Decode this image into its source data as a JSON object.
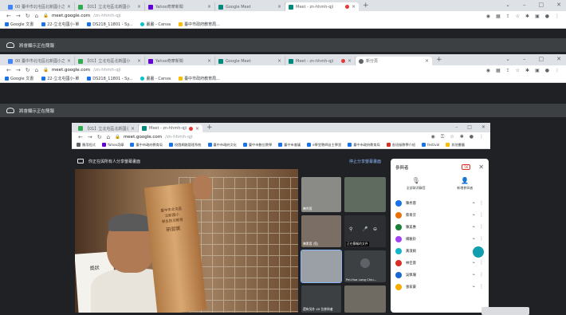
{
  "browser1": {
    "tabs": [
      {
        "label": "00 臺中市北屯區北新國小之課"
      },
      {
        "label": "【01】立北屯區北新國小"
      },
      {
        "label": "Yahoo奇摩新聞"
      },
      {
        "label": "Google Meet"
      },
      {
        "label": "Meet - zn-hhmh-qji"
      }
    ],
    "new_tab": "+",
    "url_domain": "meet.google.com",
    "url_path": "/zn-hhmh-qji",
    "bookmarks": [
      "Google 文書",
      "22-立北屯國小-單",
      "DS218_11801 - Sy...",
      "畫畫 - Canva",
      "臺中市政府教育局..."
    ],
    "present_label": "將會顯示正在簡報"
  },
  "browser2": {
    "tabs": [
      {
        "label": "00 臺中市北屯區北新國小之課"
      },
      {
        "label": "【01】立北屯區北新國小"
      },
      {
        "label": "Yahoo奇摩新聞"
      },
      {
        "label": "Google Meet"
      },
      {
        "label": "Meet - zn-hhmh-qji"
      },
      {
        "label": "新分頁"
      }
    ],
    "new_tab": "+",
    "url_domain": "meet.google.com",
    "url_path": "/zn-hhmh-qji",
    "bookmarks": [
      "Google 文書",
      "22-立北屯國小-單",
      "DS218_11801 - Sy...",
      "畫畫 - Canva",
      "臺中市政府教育局..."
    ],
    "present_label": "將會顯示正在簡報"
  },
  "browser3": {
    "tabs": [
      {
        "label": "【01】立北屯區北新國小"
      },
      {
        "label": "Meet - zn-hhmh-qji"
      }
    ],
    "new_tab": "+",
    "url_domain": "meet.google.com",
    "url_path": "/zn-hhmh-qji",
    "bookmarks": [
      "應用程式",
      "Yahoo奇摩",
      "臺中市政府教育局",
      "校園網路管理系統",
      "臺中市政府文化",
      "臺中市數位教學",
      "臺中市會議",
      "e學堂教師自主學習",
      "臺中市政府教育局",
      "各班級教學介紹",
      "festival",
      "其他書籤"
    ]
  },
  "meet": {
    "presenting_text": "你正在與所有人分享螢幕畫面",
    "stop_label": "停止分享螢幕畫面",
    "trophy_lines": [
      "臺中市北屯區",
      "北新國小",
      "學生防災教育",
      "研習獎"
    ],
    "paper_title": "獎狀",
    "tiles": [
      {
        "label": "陳秀蓉"
      },
      {
        "label": ""
      },
      {
        "label": "陳素蓉 (您)"
      },
      {
        "label": "正在簡報的文件"
      },
      {
        "label": ""
      },
      {
        "label": "Pei-Hua Long Chiu..."
      },
      {
        "label": "還有另外 49 位參與者"
      },
      {
        "label": ""
      }
    ]
  },
  "panel": {
    "title": "參與者",
    "chip": "56",
    "add_label": "新增參與者",
    "tools_label": "全部取消靜音",
    "participants": [
      {
        "name": "陳秀蓉",
        "color": "#1a73e8"
      },
      {
        "name": "蔡育芬",
        "color": "#e8710a"
      },
      {
        "name": "陳美惠",
        "color": "#188038"
      },
      {
        "name": "楊雅鈴",
        "color": "#a142f4"
      },
      {
        "name": "黃淑娟",
        "color": "#12b5cb"
      },
      {
        "name": "林佳蓉",
        "color": "#d93025"
      },
      {
        "name": "吳佩珊",
        "color": "#1967d2"
      },
      {
        "name": "張家豪",
        "color": "#f9ab00"
      }
    ]
  }
}
